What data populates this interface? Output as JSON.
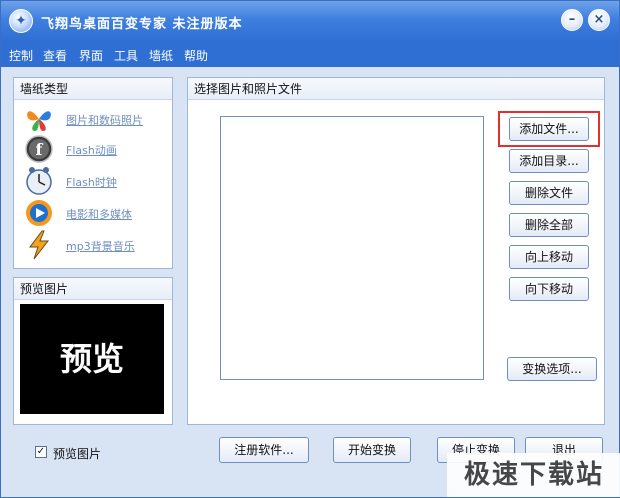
{
  "window": {
    "title": "飞翔鸟桌面百变专家   未注册版本"
  },
  "titlebar_buttons": {
    "minimize": "–",
    "close": "×"
  },
  "menu": [
    "控制",
    "查看",
    "界面",
    "工具",
    "墙纸",
    "帮助"
  ],
  "wallpaper_panel": {
    "title": "墙纸类型",
    "items": [
      {
        "label": "图片和数码照片",
        "icon": "butterfly-icon"
      },
      {
        "label": "Flash动画",
        "icon": "flash-icon"
      },
      {
        "label": "Flash时钟",
        "icon": "clock-icon"
      },
      {
        "label": "电影和多媒体",
        "icon": "media-player-icon"
      },
      {
        "label": "mp3背景音乐",
        "icon": "winamp-icon"
      }
    ]
  },
  "preview_panel": {
    "title": "预览图片",
    "image_text": "预览"
  },
  "preview_checkbox": {
    "label": "预览图片",
    "checked": true
  },
  "files_panel": {
    "title": "选择图片和照片文件",
    "buttons": {
      "add_file": "添加文件...",
      "add_dir": "添加目录...",
      "delete_file": "删除文件",
      "delete_all": "删除全部",
      "move_up": "向上移动",
      "move_down": "向下移动",
      "transform_options": "变换选项..."
    }
  },
  "bottom_buttons": {
    "register": "注册软件...",
    "start": "开始变换",
    "stop": "停止变换",
    "exit": "退出"
  },
  "watermark": "极速下载站",
  "colors": {
    "titlebar": "#2f6fd4",
    "background": "#d8e3f4",
    "highlight": "#e03030"
  }
}
